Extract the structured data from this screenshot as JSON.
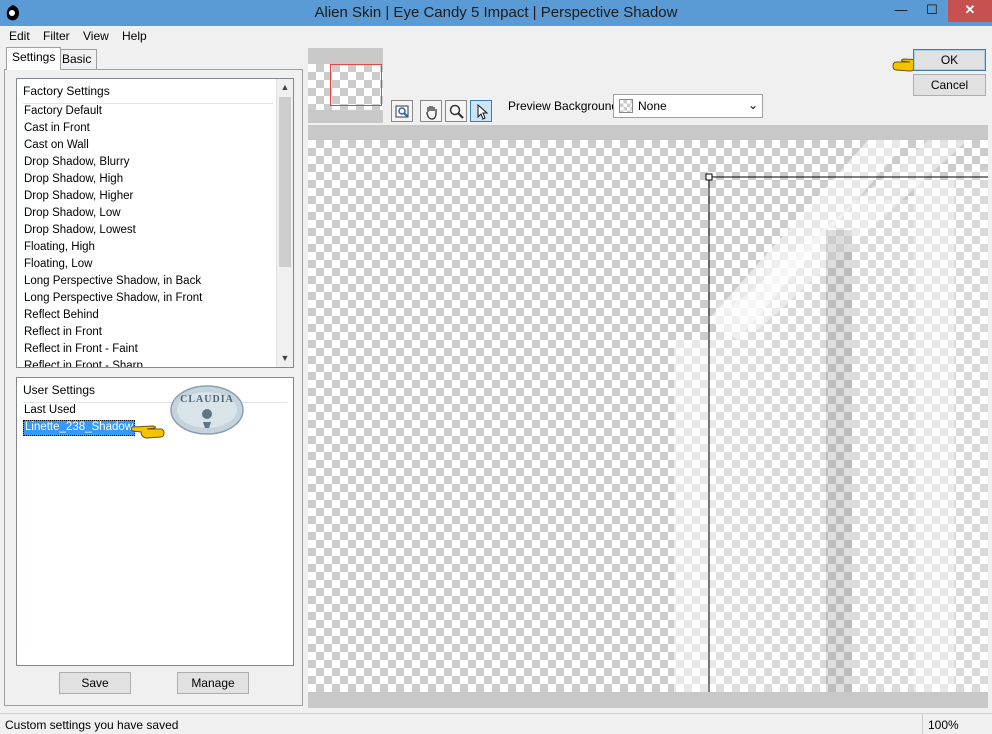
{
  "window": {
    "title": "Alien Skin | Eye Candy 5 Impact | Perspective Shadow",
    "controls": {
      "minimize": "—",
      "maximize": "☐",
      "close": "✕"
    }
  },
  "menu": {
    "items": [
      "Edit",
      "Filter",
      "View",
      "Help"
    ]
  },
  "tabs": [
    {
      "label": "Settings",
      "active": true
    },
    {
      "label": "Basic",
      "active": false
    }
  ],
  "factory_settings": {
    "header": "Factory Settings",
    "items": [
      "Factory Default",
      "Cast in Front",
      "Cast on Wall",
      "Drop Shadow, Blurry",
      "Drop Shadow, High",
      "Drop Shadow, Higher",
      "Drop Shadow, Low",
      "Drop Shadow, Lowest",
      "Floating, High",
      "Floating, Low",
      "Long Perspective Shadow, in Back",
      "Long Perspective Shadow, in Front",
      "Reflect Behind",
      "Reflect in Front",
      "Reflect in Front - Faint",
      "Reflect in Front - Sharp"
    ]
  },
  "user_settings": {
    "header": "User Settings",
    "items": [
      "Last Used",
      "Linette_238_Shadow"
    ],
    "selected": "Linette_238_Shadow"
  },
  "watermark": {
    "text": "CLAUDIA"
  },
  "buttons": {
    "save": "Save",
    "manage": "Manage",
    "ok": "OK",
    "cancel": "Cancel"
  },
  "toolbar": {
    "tools": [
      "zoom-to-fit",
      "hand",
      "zoom",
      "arrow"
    ],
    "preview_background_label": "Preview Background:",
    "preview_background_value": "None"
  },
  "status": {
    "message": "Custom settings you have saved",
    "zoom": "100%"
  },
  "colors": {
    "titlebar": "#5b9bd5",
    "selection": "#3399ff",
    "close": "#c75050",
    "hand_pointer": "#f5c400"
  }
}
